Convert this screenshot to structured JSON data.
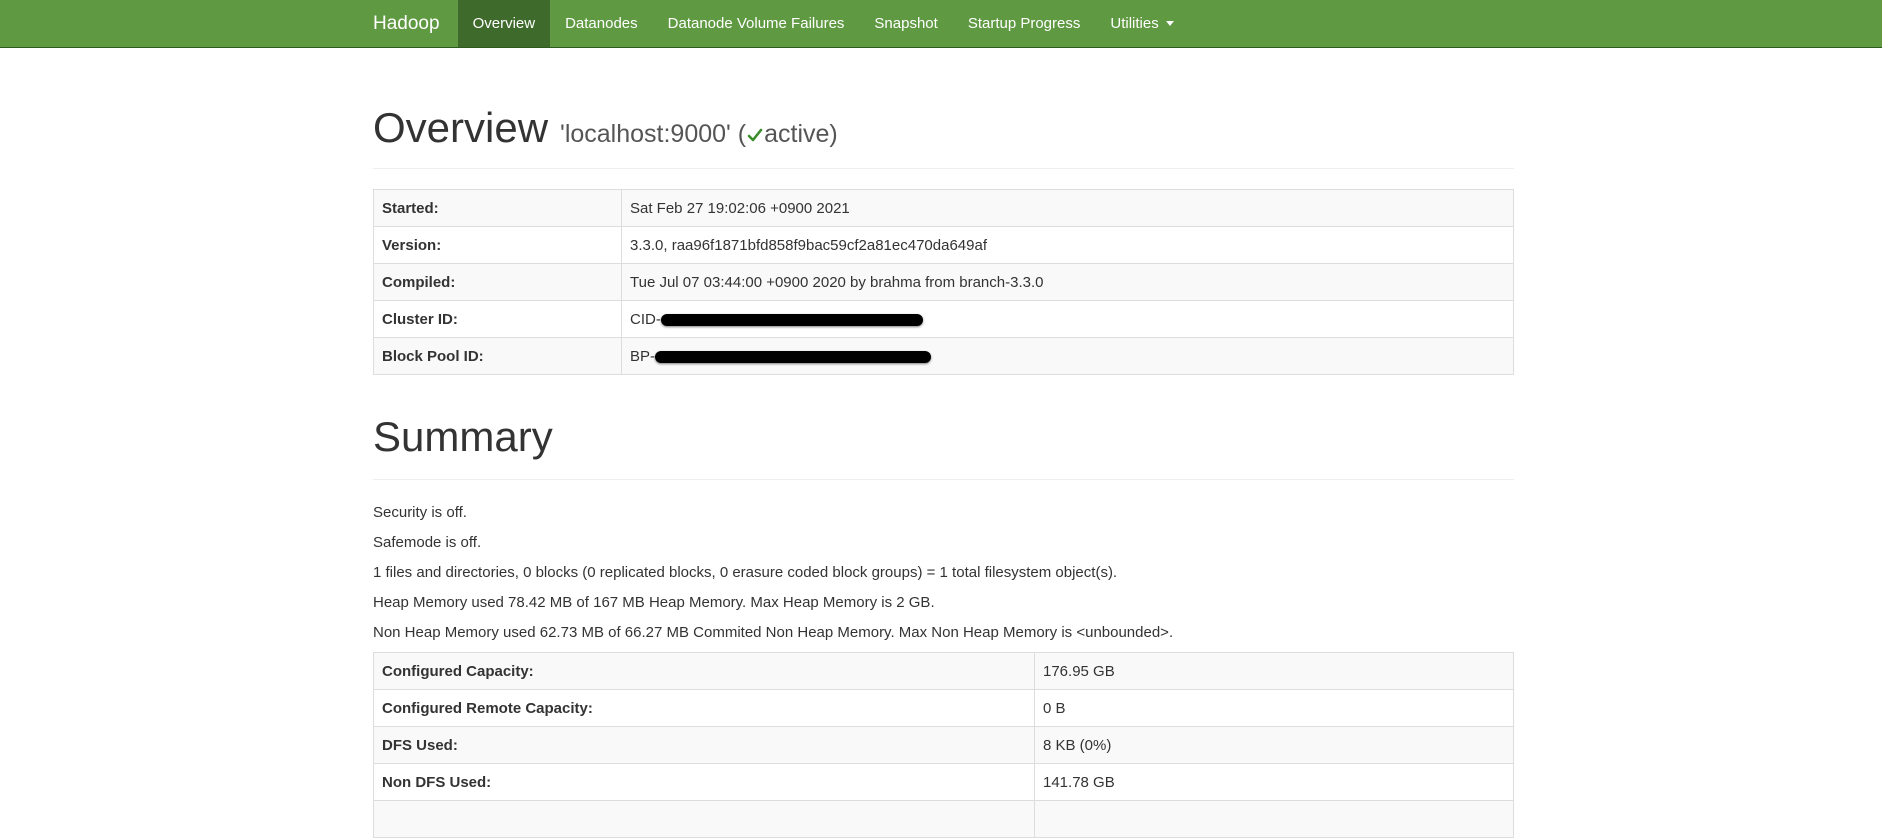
{
  "colors": {
    "navbar_bg": "#5f9942",
    "navbar_active": "#3e6a2b",
    "active_check": "#3a8d2a"
  },
  "nav": {
    "brand": "Hadoop",
    "items": [
      {
        "label": "Overview",
        "active": true
      },
      {
        "label": "Datanodes"
      },
      {
        "label": "Datanode Volume Failures"
      },
      {
        "label": "Snapshot"
      },
      {
        "label": "Startup Progress"
      },
      {
        "label": "Utilities",
        "has_dropdown": true
      }
    ]
  },
  "overview": {
    "title": "Overview",
    "host": "'localhost:9000'",
    "status_open": "(",
    "status": "active",
    "status_close": ")",
    "status_icon": "check-icon",
    "rows": [
      {
        "key": "Started:",
        "value": "Sat Feb 27 19:02:06 +0900 2021"
      },
      {
        "key": "Version:",
        "value": "3.3.0, raa96f1871bfd858f9bac59cf2a81ec470da649af"
      },
      {
        "key": "Compiled:",
        "value": "Tue Jul 07 03:44:00 +0900 2020 by brahma from branch-3.3.0"
      },
      {
        "key": "Cluster ID:",
        "value": "CID-"
      },
      {
        "key": "Block Pool ID:",
        "value": "BP-"
      }
    ]
  },
  "summary": {
    "title": "Summary",
    "lines": [
      "Security is off.",
      "Safemode is off.",
      "1 files and directories, 0 blocks (0 replicated blocks, 0 erasure coded block groups) = 1 total filesystem object(s).",
      "Heap Memory used 78.42 MB of 167 MB Heap Memory. Max Heap Memory is 2 GB.",
      "Non Heap Memory used 62.73 MB of 66.27 MB Commited Non Heap Memory. Max Non Heap Memory is <unbounded>."
    ],
    "rows": [
      {
        "key": "Configured Capacity:",
        "value": "176.95 GB"
      },
      {
        "key": "Configured Remote Capacity:",
        "value": "0 B"
      },
      {
        "key": "DFS Used:",
        "value": "8 KB (0%)"
      },
      {
        "key": "Non DFS Used:",
        "value": "141.78 GB"
      }
    ]
  }
}
